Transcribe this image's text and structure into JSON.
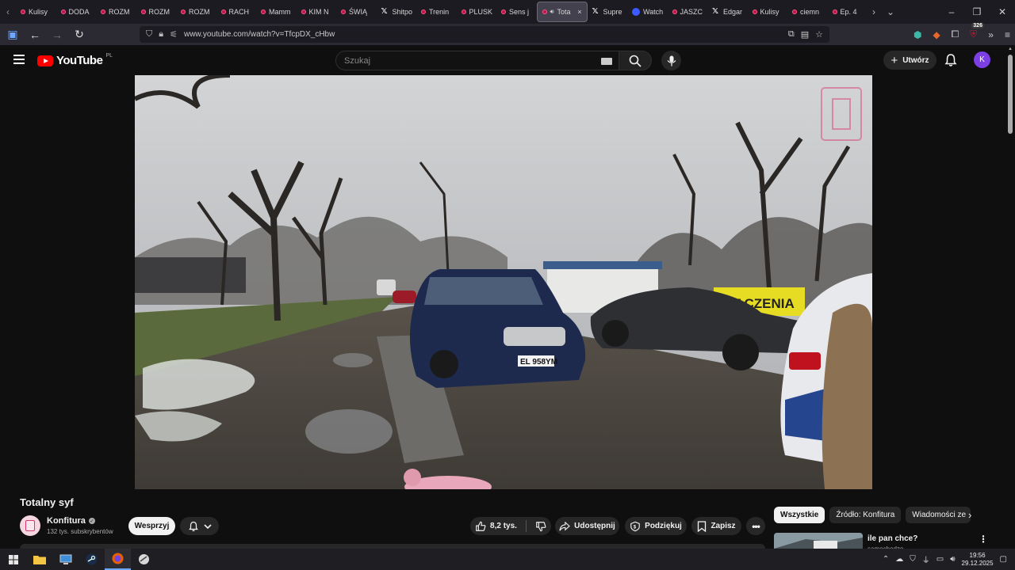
{
  "browser": {
    "tabs": [
      {
        "label": "Kulisy",
        "icon": "yt-dot"
      },
      {
        "label": "DODA",
        "icon": "yt-dot"
      },
      {
        "label": "ROZM",
        "icon": "yt-dot"
      },
      {
        "label": "ROZM",
        "icon": "yt-dot"
      },
      {
        "label": "ROZM",
        "icon": "yt-dot"
      },
      {
        "label": "RACH",
        "icon": "yt-dot"
      },
      {
        "label": "Mamm",
        "icon": "yt-dot"
      },
      {
        "label": "KIM N",
        "icon": "yt-dot"
      },
      {
        "label": "ŚWIĄ",
        "icon": "yt-dot"
      },
      {
        "label": "Shitpo",
        "icon": "x"
      },
      {
        "label": "Trenin",
        "icon": "yt-dot"
      },
      {
        "label": "PLUSK",
        "icon": "yt-dot"
      },
      {
        "label": "Sens j",
        "icon": "yt-dot"
      }
    ],
    "active_tab": {
      "label": "Tota",
      "close": "×"
    },
    "tabs_after": [
      {
        "label": "Supre",
        "icon": "x"
      },
      {
        "label": "Watch",
        "icon": "blue"
      },
      {
        "label": "JASZC",
        "icon": "yt-dot"
      },
      {
        "label": "Edgar",
        "icon": "x"
      },
      {
        "label": "Kulisy",
        "icon": "yt-dot"
      },
      {
        "label": "ciemn",
        "icon": "yt-dot"
      },
      {
        "label": "Ep. 4",
        "icon": "yt-dot"
      }
    ],
    "url": "www.youtube.com/watch?v=TfcpDX_cHbw",
    "extensions_badge": "326"
  },
  "youtube": {
    "logo_text": "YouTube",
    "region": "PL",
    "search_placeholder": "Szukaj",
    "create_label": "Utwórz",
    "avatar_letter": "K"
  },
  "video": {
    "title": "Totalny syf",
    "overlay_sign": "MACZENIA",
    "plate": "EL 958YM"
  },
  "channel": {
    "name": "Konfitura",
    "subscribers": "132 tys. subskrybentów",
    "support_label": "Wesprzyj"
  },
  "actions": {
    "likes": "8,2 tys.",
    "share": "Udostępnij",
    "thanks": "Podziękuj",
    "save": "Zapisz"
  },
  "sidebar": {
    "chips": [
      "Wszystkie",
      "Źródło: Konfitura",
      "Wiadomości ze"
    ],
    "rec_title": "ile pan chce?",
    "rec_channel": "samochodzo"
  },
  "taskbar": {
    "time": "19:56",
    "date": "29.12.2025"
  },
  "colors": {
    "yt_red": "#ff0000",
    "avatar_purple": "#7b3fe4",
    "background": "#0f0f0f"
  }
}
